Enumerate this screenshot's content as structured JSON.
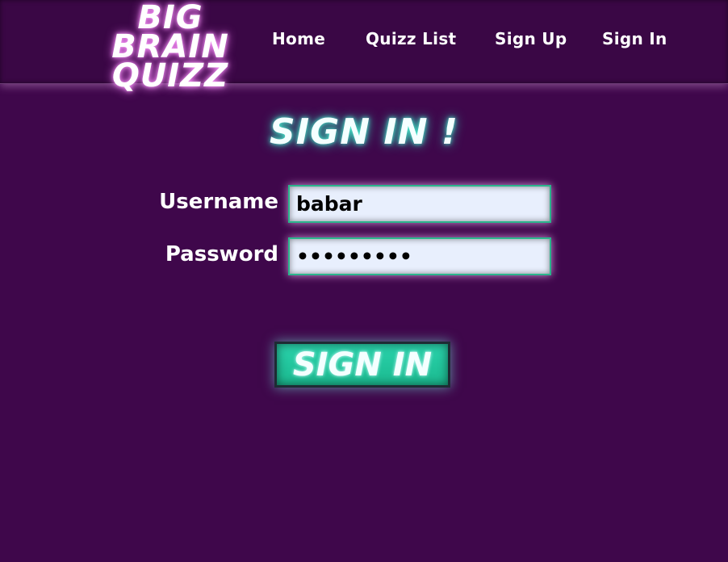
{
  "header": {
    "logo_line1": "BIG BRAIN",
    "logo_line2": "QUIZZ",
    "nav": {
      "home": "Home",
      "quizz_list": "Quizz List",
      "sign_up": "Sign Up",
      "sign_in": "Sign In"
    }
  },
  "form": {
    "title": "SIGN IN !",
    "username_label": "Username",
    "username_value": "babar",
    "password_label": "Password",
    "password_value": "•••••••••",
    "submit_label": "SIGN IN"
  },
  "colors": {
    "background": "#3f074b",
    "header_bg": "#3a0745",
    "accent_teal": "#2ad3ac",
    "field_bg": "#e8effd",
    "field_border": "#2bb48c"
  }
}
